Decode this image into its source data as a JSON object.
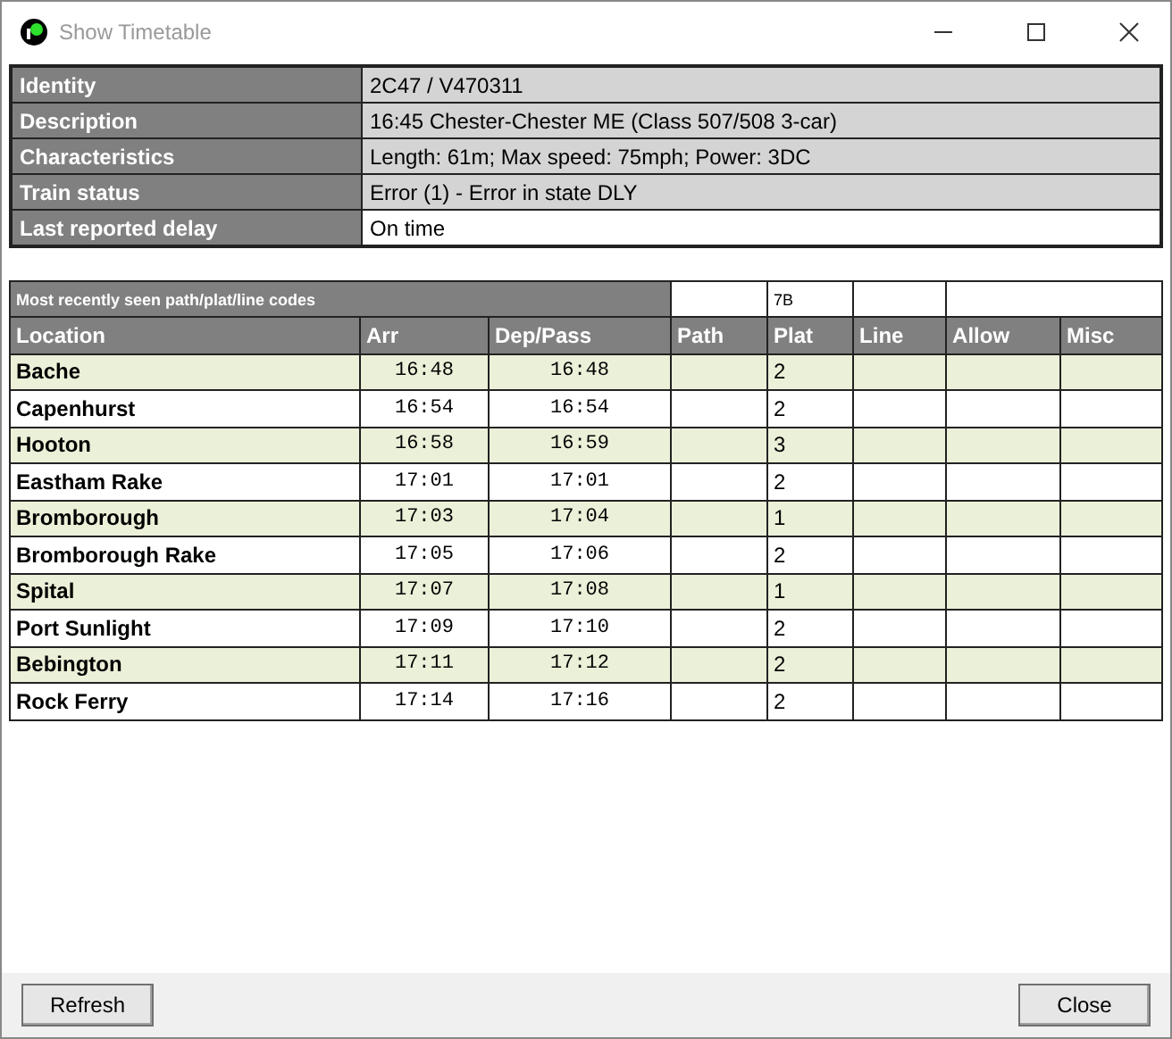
{
  "window": {
    "title": "Show Timetable"
  },
  "info": [
    {
      "label": "Identity",
      "value": "2C47 / V470311",
      "shaded": true
    },
    {
      "label": "Description",
      "value": "16:45 Chester-Chester ME (Class 507/508 3-car)",
      "shaded": true
    },
    {
      "label": "Characteristics",
      "value": "Length: 61m; Max speed: 75mph; Power: 3DC",
      "shaded": true
    },
    {
      "label": "Train status",
      "value": "Error (1) - Error in state DLY",
      "shaded": true
    },
    {
      "label": "Last reported delay",
      "value": "On time",
      "shaded": false
    }
  ],
  "codes": {
    "label": "Most recently seen path/plat/line codes",
    "plat": "7B"
  },
  "table": {
    "columns": [
      "Location",
      "Arr",
      "Dep/Pass",
      "Path",
      "Plat",
      "Line",
      "Allow",
      "Misc"
    ],
    "rows": [
      {
        "location": "Bache",
        "arr": "16:48",
        "dep": "16:48",
        "plat": "2"
      },
      {
        "location": "Capenhurst",
        "arr": "16:54",
        "dep": "16:54",
        "plat": "2"
      },
      {
        "location": "Hooton",
        "arr": "16:58",
        "dep": "16:59",
        "plat": "3"
      },
      {
        "location": "Eastham Rake",
        "arr": "17:01",
        "dep": "17:01",
        "plat": "2"
      },
      {
        "location": "Bromborough",
        "arr": "17:03",
        "dep": "17:04",
        "plat": "1"
      },
      {
        "location": "Bromborough Rake",
        "arr": "17:05",
        "dep": "17:06",
        "plat": "2"
      },
      {
        "location": "Spital",
        "arr": "17:07",
        "dep": "17:08",
        "plat": "1"
      },
      {
        "location": "Port Sunlight",
        "arr": "17:09",
        "dep": "17:10",
        "plat": "2"
      },
      {
        "location": "Bebington",
        "arr": "17:11",
        "dep": "17:12",
        "plat": "2"
      },
      {
        "location": "Rock Ferry",
        "arr": "17:14",
        "dep": "17:16",
        "plat": "2"
      }
    ]
  },
  "buttons": [
    "Refresh",
    "Close"
  ]
}
